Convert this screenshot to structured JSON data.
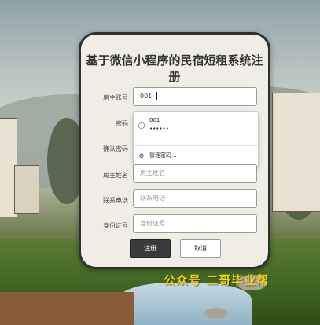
{
  "form": {
    "title": "基于微信小程序的民宿短租系统注册",
    "fields": {
      "account": {
        "label": "房主账号",
        "value": "001"
      },
      "password": {
        "label": "密码"
      },
      "confirm": {
        "label": "确认密码"
      },
      "name": {
        "label": "房主姓名",
        "placeholder": "房主姓名"
      },
      "phone": {
        "label": "联系电话",
        "placeholder": "联系电话"
      },
      "idcard": {
        "label": "身份证号",
        "placeholder": "身份证号"
      }
    },
    "autocomplete": {
      "username": "001",
      "password_mask": "••••••",
      "manage_label": "管理密码..."
    },
    "buttons": {
      "register": "注册",
      "cancel": "取消"
    }
  },
  "watermark": "公众号 二哥毕业帮"
}
